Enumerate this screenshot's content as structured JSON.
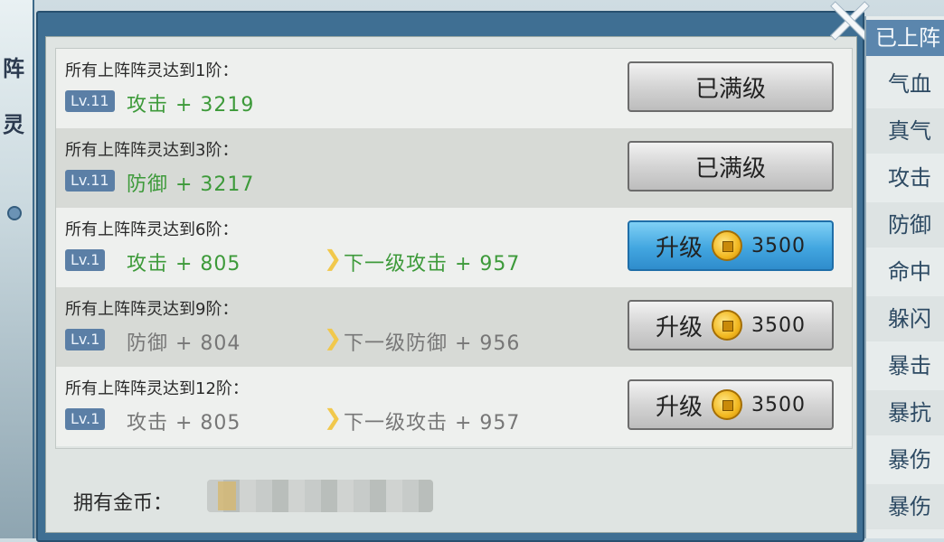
{
  "left_strip": {
    "chars": [
      "阵",
      "灵"
    ]
  },
  "rows": [
    {
      "title": "所有上阵阵灵达到1阶：",
      "level": "Lv.11",
      "stat": "攻击 + 3219",
      "next": "",
      "button": {
        "label": "已满级",
        "cost": ""
      },
      "button_style": "maxed",
      "stat_color": "green"
    },
    {
      "title": "所有上阵阵灵达到3阶：",
      "level": "Lv.11",
      "stat": "防御 + 3217",
      "next": "",
      "button": {
        "label": "已满级",
        "cost": ""
      },
      "button_style": "maxed",
      "stat_color": "green"
    },
    {
      "title": "所有上阵阵灵达到6阶：",
      "level": "Lv.1",
      "stat": "攻击 + 805",
      "next": "下一级攻击 + 957",
      "button": {
        "label": "升级",
        "cost": "3500"
      },
      "button_style": "active",
      "stat_color": "green"
    },
    {
      "title": "所有上阵阵灵达到9阶：",
      "level": "Lv.1",
      "stat": "防御 + 804",
      "next": "下一级防御 + 956",
      "button": {
        "label": "升级",
        "cost": "3500"
      },
      "button_style": "inactive",
      "stat_color": "gray"
    },
    {
      "title": "所有上阵阵灵达到12阶：",
      "level": "Lv.1",
      "stat": "攻击 + 805",
      "next": "下一级攻击 + 957",
      "button": {
        "label": "升级",
        "cost": "3500"
      },
      "button_style": "inactive",
      "stat_color": "gray"
    }
  ],
  "footer": {
    "gold_label": "拥有金币："
  },
  "right_panel": {
    "header": "已上阵",
    "attributes": [
      "气血",
      "真气",
      "攻击",
      "防御",
      "命中",
      "躲闪",
      "暴击",
      "暴抗",
      "暴伤",
      "暴伤"
    ]
  },
  "colors": {
    "active_button": "#42a6e0",
    "stat_green": "#3d9a3a",
    "stat_gray": "#777777",
    "panel_border": "#3f6f93"
  }
}
